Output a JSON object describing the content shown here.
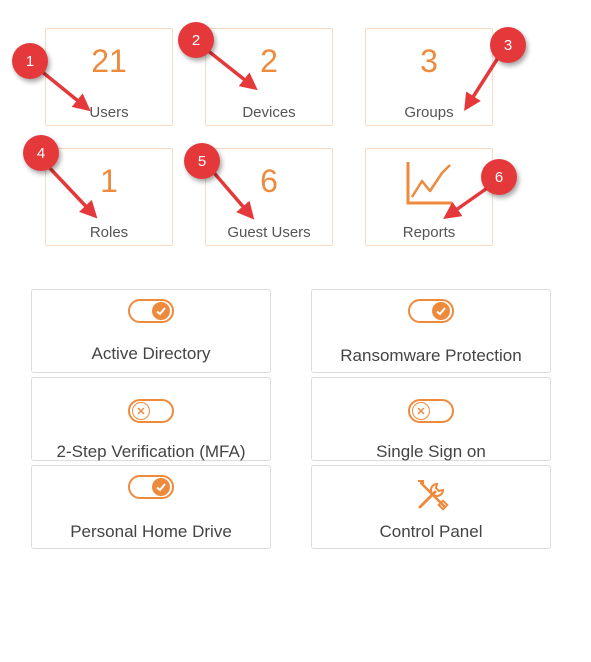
{
  "stats": [
    {
      "number": "21",
      "label": "Users"
    },
    {
      "number": "2",
      "label": "Devices"
    },
    {
      "number": "3",
      "label": "Groups"
    },
    {
      "number": "1",
      "label": "Roles"
    },
    {
      "number": "6",
      "label": "Guest Users"
    },
    {
      "label": "Reports",
      "icon": "chart-line-icon"
    }
  ],
  "features": [
    {
      "label": "Active Directory",
      "state": "on"
    },
    {
      "label": "Ransomware Protection",
      "state": "on"
    },
    {
      "label": "2-Step Verification (MFA)",
      "state": "off"
    },
    {
      "label": "Single Sign on",
      "state": "off"
    },
    {
      "label": "Personal Home Drive",
      "state": "on"
    },
    {
      "label": "Control Panel",
      "icon": "tools-icon"
    }
  ],
  "callouts": [
    "1",
    "2",
    "3",
    "4",
    "5",
    "6"
  ],
  "colors": {
    "accent": "#ee8a3c",
    "callout": "#e5383b",
    "tile_border": "#f6dcc4"
  }
}
